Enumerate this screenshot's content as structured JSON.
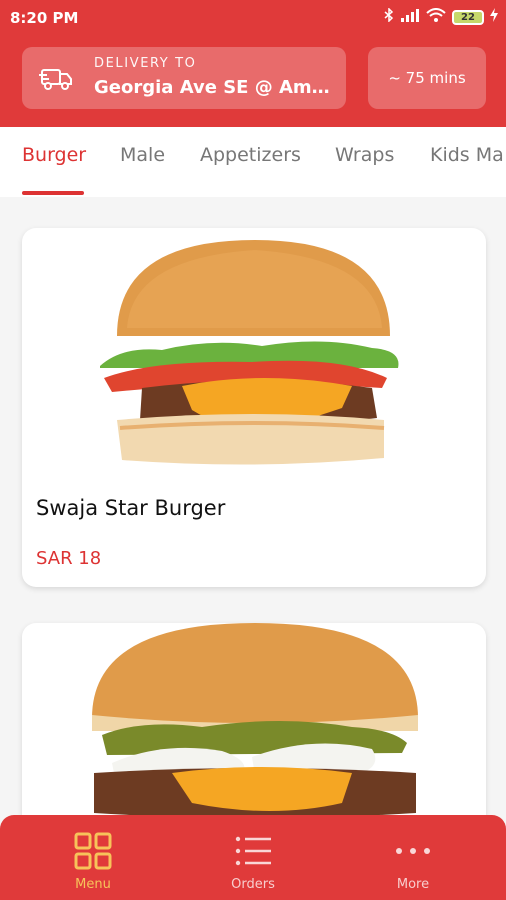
{
  "status_bar": {
    "time": "8:20 PM",
    "battery": "22"
  },
  "header": {
    "delivery_label": "DELIVERY TO",
    "delivery_address": "Georgia Ave SE @ Ami S...",
    "eta": "~ 75 mins",
    "colors": {
      "header_bg": "#e03a3a",
      "accent": "#d33333"
    }
  },
  "tabs": [
    {
      "label": "Burger",
      "active": true
    },
    {
      "label": "Male",
      "active": false
    },
    {
      "label": "Appetizers",
      "active": false
    },
    {
      "label": "Wraps",
      "active": false
    },
    {
      "label": "Kids Ma",
      "active": false
    }
  ],
  "menu_items": [
    {
      "name": "Swaja Star Burger",
      "price": "SAR 18"
    },
    {
      "name": "",
      "price": ""
    }
  ],
  "bottom_nav": [
    {
      "label": "Menu",
      "icon": "grid-icon",
      "active": true
    },
    {
      "label": "Orders",
      "icon": "list-icon",
      "active": false
    },
    {
      "label": "More",
      "icon": "more-dots-icon",
      "active": false
    }
  ]
}
